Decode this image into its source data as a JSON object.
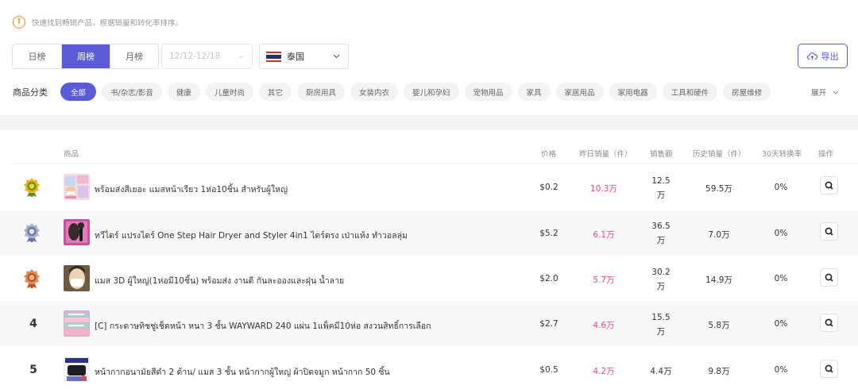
{
  "hint": {
    "text": "快速找到畅销产品，根据销量和转化率排序。",
    "icon": "exclamation-circle-icon"
  },
  "period_tabs": [
    {
      "label": "日榜",
      "active": false
    },
    {
      "label": "周榜",
      "active": true
    },
    {
      "label": "月榜",
      "active": false
    }
  ],
  "date_range": {
    "value": "12/12-12/18"
  },
  "country": {
    "label": "泰国",
    "flag": "thailand-flag-icon"
  },
  "export_label": "导出",
  "category_label": "商品分类",
  "categories": [
    {
      "label": "全部",
      "active": true
    },
    {
      "label": "书/杂志/影音"
    },
    {
      "label": "健康"
    },
    {
      "label": "儿童时尚"
    },
    {
      "label": "其它"
    },
    {
      "label": "厨房用具"
    },
    {
      "label": "女装内衣"
    },
    {
      "label": "婴儿和孕妇"
    },
    {
      "label": "宠物用品"
    },
    {
      "label": "家具"
    },
    {
      "label": "家居用品"
    },
    {
      "label": "家用电器"
    },
    {
      "label": "工具和硬件"
    },
    {
      "label": "房屋维修"
    }
  ],
  "expand_label": "展开",
  "columns": {
    "product": "商品",
    "price": "价格",
    "yesterday_sales": "昨日销量（件）",
    "revenue": "销售额",
    "total_sales": "历史销量（件）",
    "conversion": "30天转换率",
    "action": "操作"
  },
  "colors": {
    "accent": "#5b5bd6",
    "sales_highlight": "#e8488e",
    "warning": "#f08a24"
  },
  "rows": [
    {
      "rank": "1",
      "rank_badge": "gold-medal-icon",
      "name": "พร้อมส่งสีเยอะ แมสหน้าเรียว 1ห่อ10ชิ้น สำหรับผู้ใหญ่",
      "price": "$0.2",
      "yesterday_sales": "10.3万",
      "revenue_line1": "12.5",
      "revenue_line2": "万",
      "total_sales": "59.5万",
      "conversion": "0%"
    },
    {
      "rank": "2",
      "rank_badge": "silver-medal-icon",
      "name": "ทวีไดร์ แปรงไดร์ One Step Hair Dryer and Styler 4in1 ไดร์ตรง เป่าแห้ง ทำวอลลุ่ม",
      "price": "$5.2",
      "yesterday_sales": "6.1万",
      "revenue_line1": "36.5",
      "revenue_line2": "万",
      "total_sales": "7.0万",
      "conversion": "0%"
    },
    {
      "rank": "3",
      "rank_badge": "bronze-medal-icon",
      "name": "แมส 3D ผู้ใหญ่(1ห่อมี10ชิ้น) พร้อมส่ง งานดี กันละอองและฝุ่น น้ำลาย",
      "price": "$2.0",
      "yesterday_sales": "5.7万",
      "revenue_line1": "30.2",
      "revenue_line2": "万",
      "total_sales": "14.9万",
      "conversion": "0%"
    },
    {
      "rank": "4",
      "name": "[C] กระดาษทิชชู่เช็ดหน้า หนา 3 ชั้น WAYWARD 240 แผ่น 1แพ็คมี10ห่อ สงวนสิทธิ์การเลือก",
      "price": "$2.7",
      "yesterday_sales": "4.6万",
      "revenue_line1": "15.5",
      "revenue_line2": "万",
      "total_sales": "5.8万",
      "conversion": "0%"
    },
    {
      "rank": "5",
      "name": "หน้ากากอนามัยสีดำ 2 ด้าน/ แมส 3 ชั้น หน้ากากผู้ใหญ่ ผ้าปิดจมูก หน้ากาก 50 ชิ้น",
      "price": "$0.5",
      "yesterday_sales": "4.2万",
      "revenue_line1": "4.4万",
      "revenue_line2": "",
      "total_sales": "9.8万",
      "conversion": "0%"
    }
  ]
}
